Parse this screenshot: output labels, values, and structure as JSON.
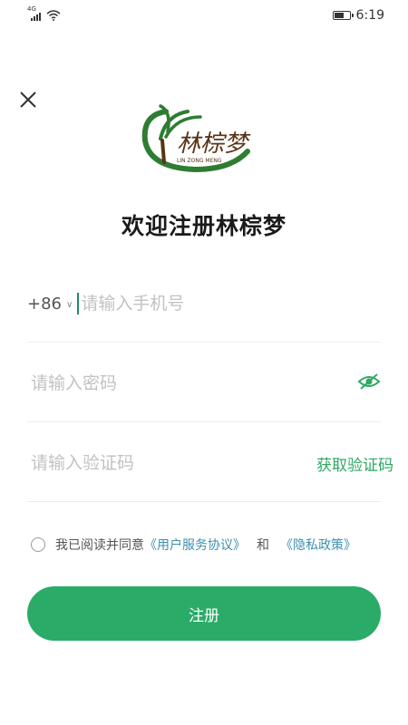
{
  "status_bar": {
    "network": "4G",
    "time": "6:19",
    "battery_level": 0.7
  },
  "logo": {
    "brand": "林棕梦",
    "subtext": "LIN ZONG MENG"
  },
  "title": "欢迎注册林棕梦",
  "phone": {
    "country_code": "+86",
    "placeholder": "请输入手机号",
    "value": ""
  },
  "password": {
    "placeholder": "请输入密码",
    "value": ""
  },
  "code": {
    "placeholder": "请输入验证码",
    "value": "",
    "get_code_label": "获取验证码"
  },
  "agreement": {
    "prefix": "我已阅读并同意",
    "terms_link": "《用户服务协议》",
    "and": "和",
    "privacy_link": "《隐私政策》",
    "checked": false
  },
  "register_label": "注册",
  "colors": {
    "accent": "#2bab68",
    "link": "#3d8fb0",
    "logo_green": "#2e7d32",
    "logo_brown": "#5a3316"
  }
}
